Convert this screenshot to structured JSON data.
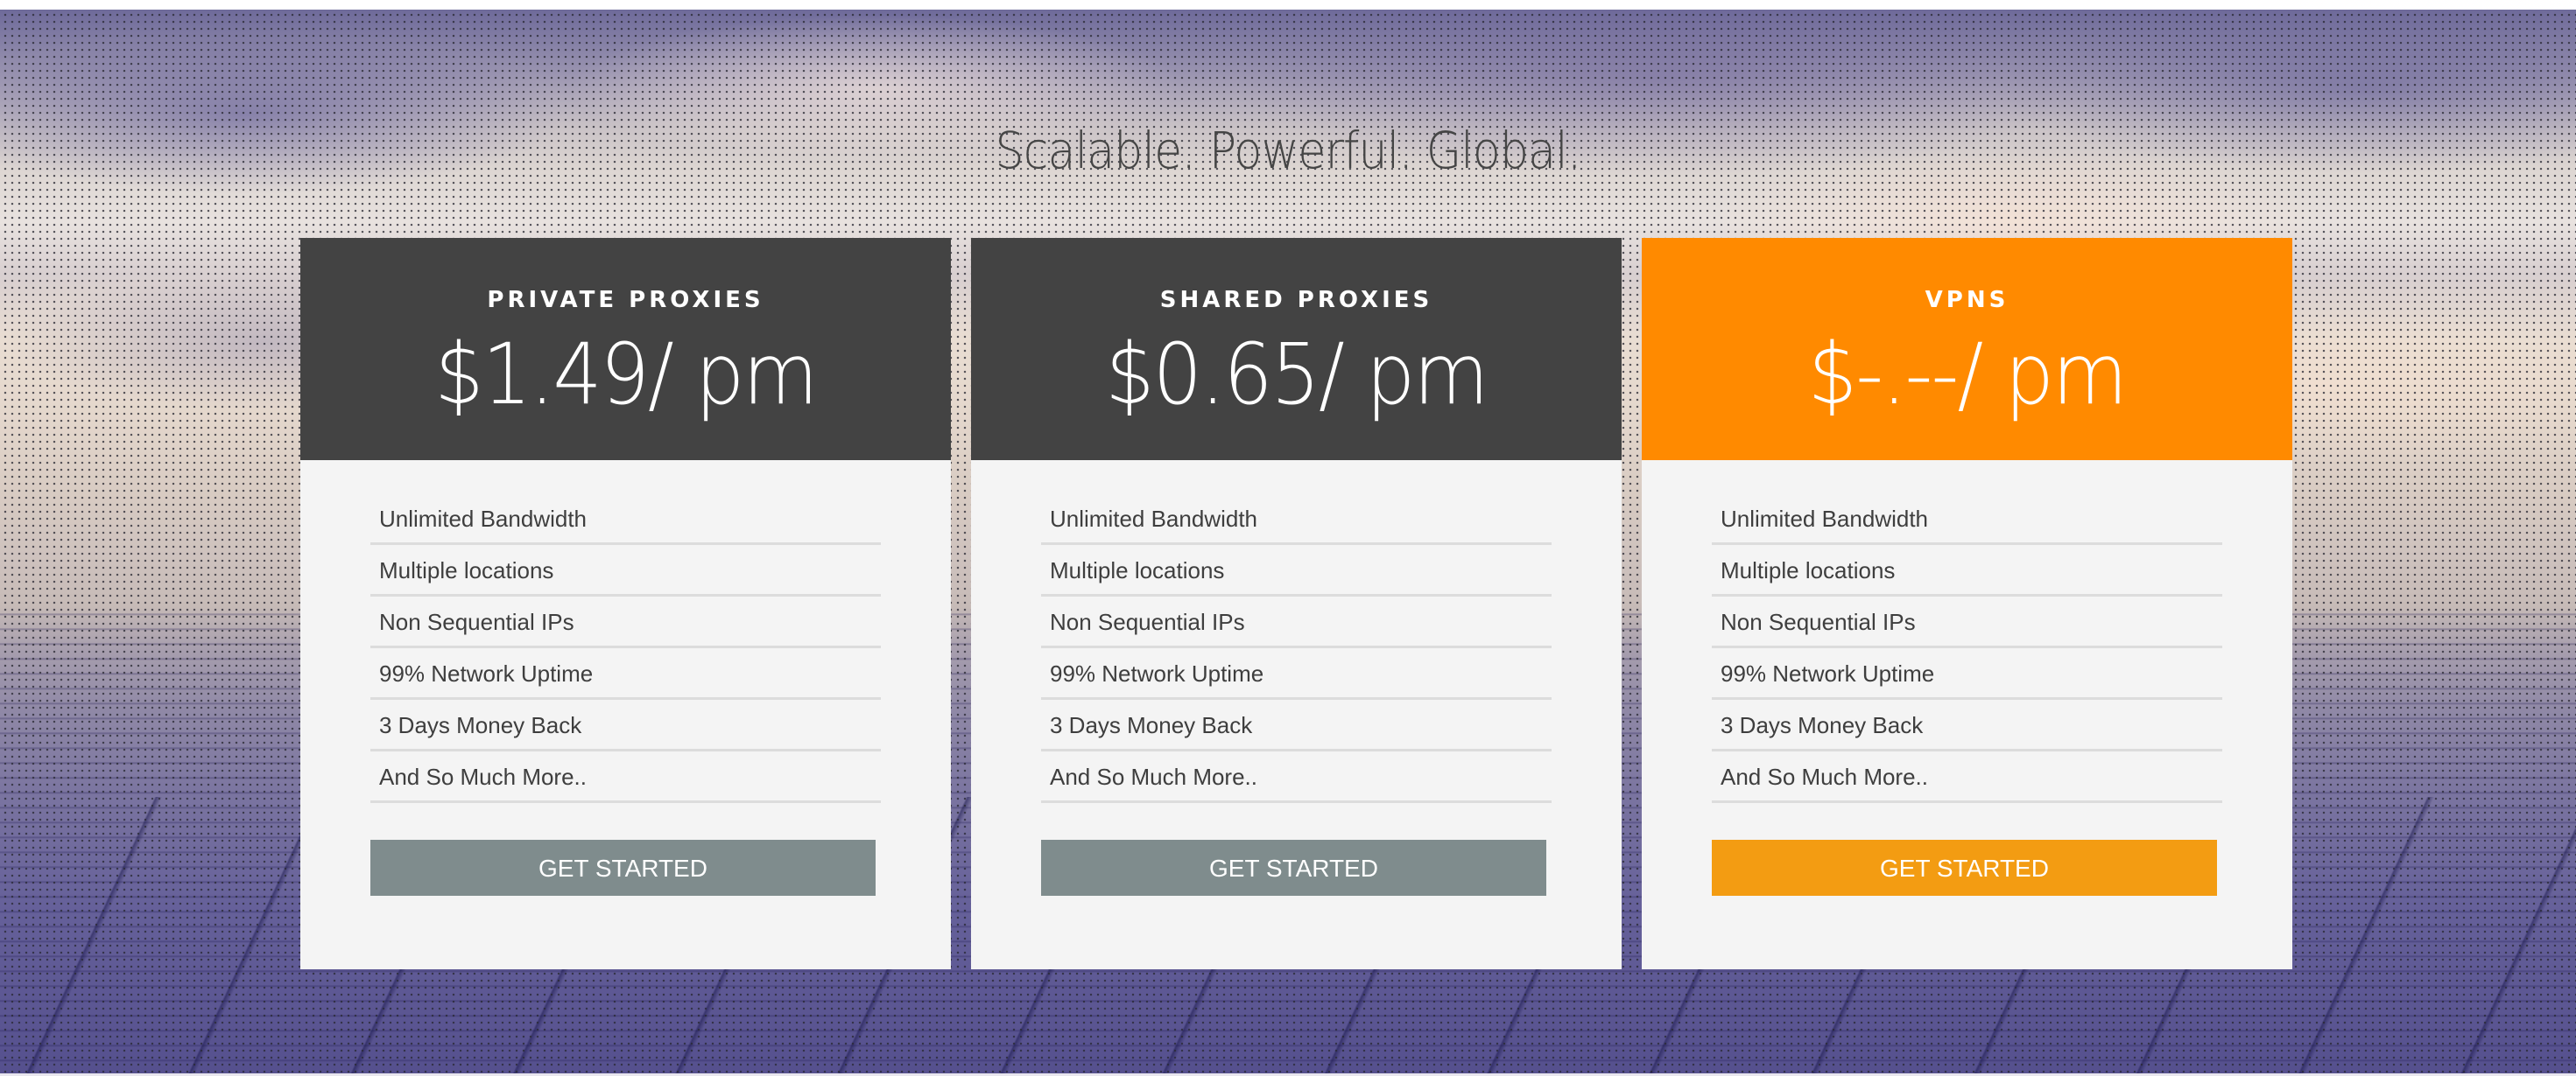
{
  "headline": "Scalable. Powerful. Global.",
  "colors": {
    "card_header_dark": "#434343",
    "card_header_accent": "#ff8a00",
    "button_neutral": "#7f8c8d",
    "button_accent": "#f39c12",
    "card_body": "#f4f4f4"
  },
  "plans": [
    {
      "name": "PRIVATE PROXIES",
      "price": "$1.49/ pm",
      "features": [
        "Unlimited Bandwidth",
        "Multiple locations",
        "Non Sequential IPs",
        "99% Network Uptime",
        "3 Days Money Back",
        "And So Much More.."
      ],
      "button_label": "GET STARTED"
    },
    {
      "name": "SHARED PROXIES",
      "price": "$0.65/ pm",
      "features": [
        "Unlimited Bandwidth",
        "Multiple locations",
        "Non Sequential IPs",
        "99% Network Uptime",
        "3 Days Money Back",
        "And So Much More.."
      ],
      "button_label": "GET STARTED"
    },
    {
      "name": "VPNS",
      "price": "$-.--/ pm",
      "features": [
        "Unlimited Bandwidth",
        "Multiple locations",
        "Non Sequential IPs",
        "99% Network Uptime",
        "3 Days Money Back",
        "And So Much More.."
      ],
      "button_label": "GET STARTED"
    }
  ]
}
